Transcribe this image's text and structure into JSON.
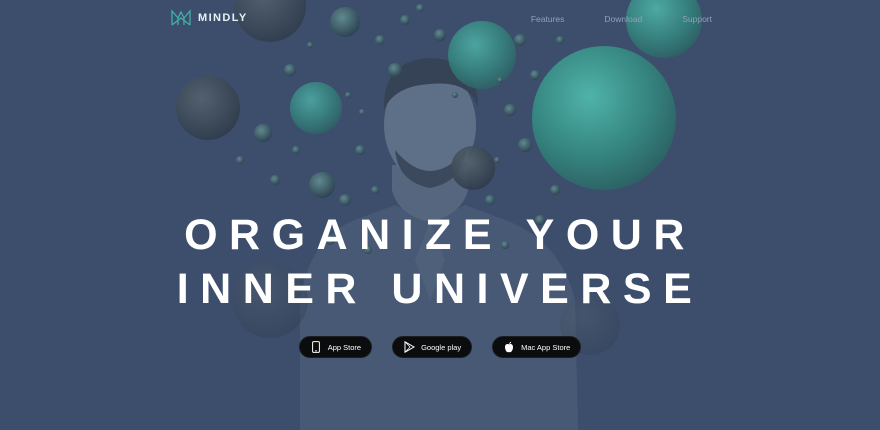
{
  "brand": {
    "name": "MINDLY",
    "logo_icon": "mindly-logo-icon"
  },
  "nav": {
    "links": [
      "Features",
      "Download",
      "Support"
    ]
  },
  "hero": {
    "headline_line1": "ORGANIZE YOUR",
    "headline_line2": "INNER UNIVERSE",
    "background": "man-with-spheres-photo"
  },
  "stores": [
    {
      "label": "App Store",
      "icon": "phone-icon"
    },
    {
      "label": "Google play",
      "icon": "play-icon"
    },
    {
      "label": "Mac App Store",
      "icon": "apple-icon"
    }
  ],
  "colors": {
    "background": "#3d4e6d",
    "accent": "#3fa39c",
    "button": "#0b0c0e",
    "text": "#ffffff"
  }
}
